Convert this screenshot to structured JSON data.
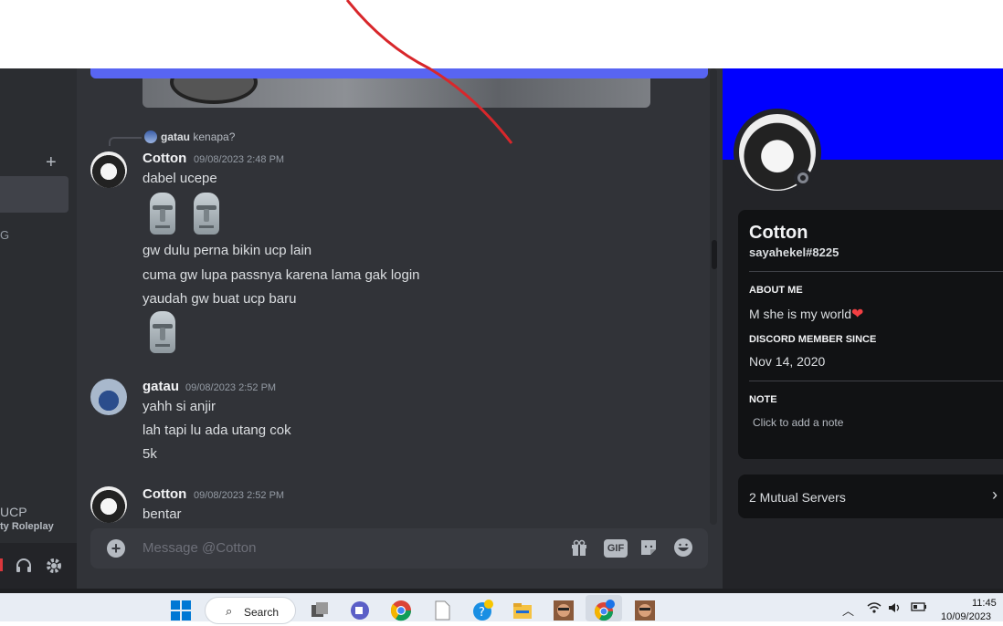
{
  "sidebar": {
    "add_label": "+",
    "channel_fragment": "G",
    "server_name_fragment": "UCP",
    "server_sub_fragment": "ty Roleplay",
    "headset_icon": "headphones-icon",
    "settings_icon": "gear-icon"
  },
  "chat": {
    "reply": {
      "author": "gatau",
      "text": "kenapa?"
    },
    "groups": [
      {
        "author": "Cotton",
        "timestamp": "09/08/2023 2:48 PM",
        "lines": [
          "dabel ucepe",
          "gw dulu perna bikin ucp lain",
          "cuma gw lupa passnya karena lama gak login",
          "yaudah gw buat ucp baru"
        ]
      },
      {
        "author": "gatau",
        "timestamp": "09/08/2023 2:52 PM",
        "lines": [
          "yahh si anjir",
          "lah tapi lu ada utang cok",
          "5k"
        ]
      },
      {
        "author": "Cotton",
        "timestamp": "09/08/2023 2:52 PM",
        "lines": [
          "bentar"
        ]
      }
    ],
    "composer": {
      "placeholder": "Message @Cotton",
      "gif_label": "GIF"
    }
  },
  "profile": {
    "banner_color": "#0000ff",
    "display_name": "Cotton",
    "username": "sayahekel#8225",
    "about_header": "ABOUT ME",
    "about_text": "M she is my world",
    "member_since_header": "DISCORD MEMBER SINCE",
    "member_since": "Nov 14, 2020",
    "note_header": "NOTE",
    "note_placeholder": "Click to add a note",
    "mutual_servers": "2 Mutual Servers"
  },
  "taskbar": {
    "search_label": "Search",
    "time": "11:45",
    "date": "10/09/2023"
  }
}
